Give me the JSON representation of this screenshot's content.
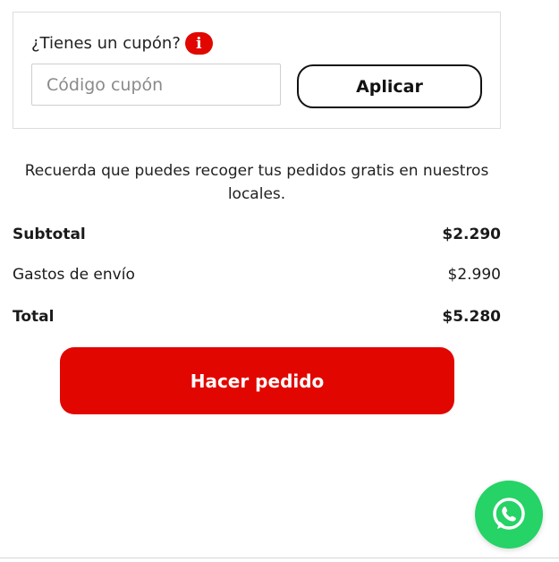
{
  "coupon": {
    "question": "¿Tienes un cupón?",
    "info_symbol": "i",
    "input_value": "",
    "input_placeholder": "Código cupón",
    "apply_label": "Aplicar"
  },
  "pickup_note": "Recuerda que puedes recoger tus pedidos gratis en nuestros locales.",
  "summary": {
    "subtotal_label": "Subtotal",
    "subtotal_value": "$2.290",
    "shipping_label": "Gastos de envío",
    "shipping_value": "$2.990",
    "total_label": "Total",
    "total_value": "$5.280"
  },
  "order_button_label": "Hacer pedido",
  "icons": {
    "info": "info-icon",
    "whatsapp": "whatsapp-icon"
  },
  "colors": {
    "accent": "#e10600",
    "whatsapp": "#25d366",
    "text": "#1a1a1a"
  }
}
